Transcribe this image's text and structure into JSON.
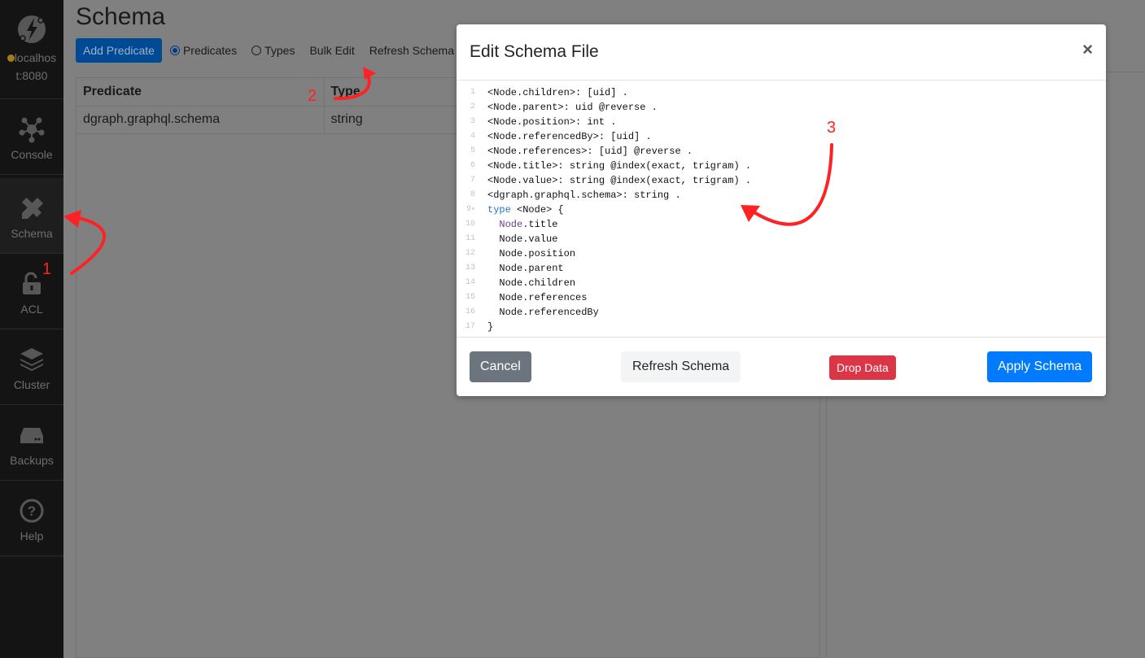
{
  "sidebar": {
    "server": {
      "label": "localhos t:8080",
      "status_color": "#a07c1c"
    },
    "items": [
      {
        "label": "Console",
        "icon": "console-icon"
      },
      {
        "label": "Schema",
        "icon": "schema-icon",
        "active": true
      },
      {
        "label": "ACL",
        "icon": "lock-icon"
      },
      {
        "label": "Cluster",
        "icon": "layers-icon"
      },
      {
        "label": "Backups",
        "icon": "drive-icon"
      },
      {
        "label": "Help",
        "icon": "help-icon"
      }
    ]
  },
  "page": {
    "title": "Schema",
    "toolbar": {
      "add_predicate": "Add Predicate",
      "radio_predicates": "Predicates",
      "radio_types": "Types",
      "selected": "Predicates",
      "bulk_edit": "Bulk Edit",
      "refresh_schema": "Refresh Schema"
    },
    "table": {
      "headers": [
        "Predicate",
        "Type"
      ],
      "rows": [
        [
          "dgraph.graphql.schema",
          "string"
        ]
      ]
    }
  },
  "modal": {
    "title": "Edit Schema File",
    "close": "×",
    "code_lines": [
      "<Node.children>: [uid] .",
      "<Node.parent>: uid @reverse .",
      "<Node.position>: int .",
      "<Node.referencedBy>: [uid] .",
      "<Node.references>: [uid] @reverse .",
      "<Node.title>: string @index(exact, trigram) .",
      "<Node.value>: string @index(exact, trigram) .",
      "<dgraph.graphql.schema>: string .",
      "type <Node> {",
      "  Node.title",
      "  Node.value",
      "  Node.position",
      "  Node.parent",
      "  Node.children",
      "  Node.references",
      "  Node.referencedBy",
      "}"
    ],
    "buttons": {
      "cancel": "Cancel",
      "refresh": "Refresh Schema",
      "drop": "Drop Data",
      "apply": "Apply Schema"
    }
  },
  "annotations": {
    "one": "1",
    "two": "2",
    "three": "3",
    "color": "#ff2222"
  }
}
